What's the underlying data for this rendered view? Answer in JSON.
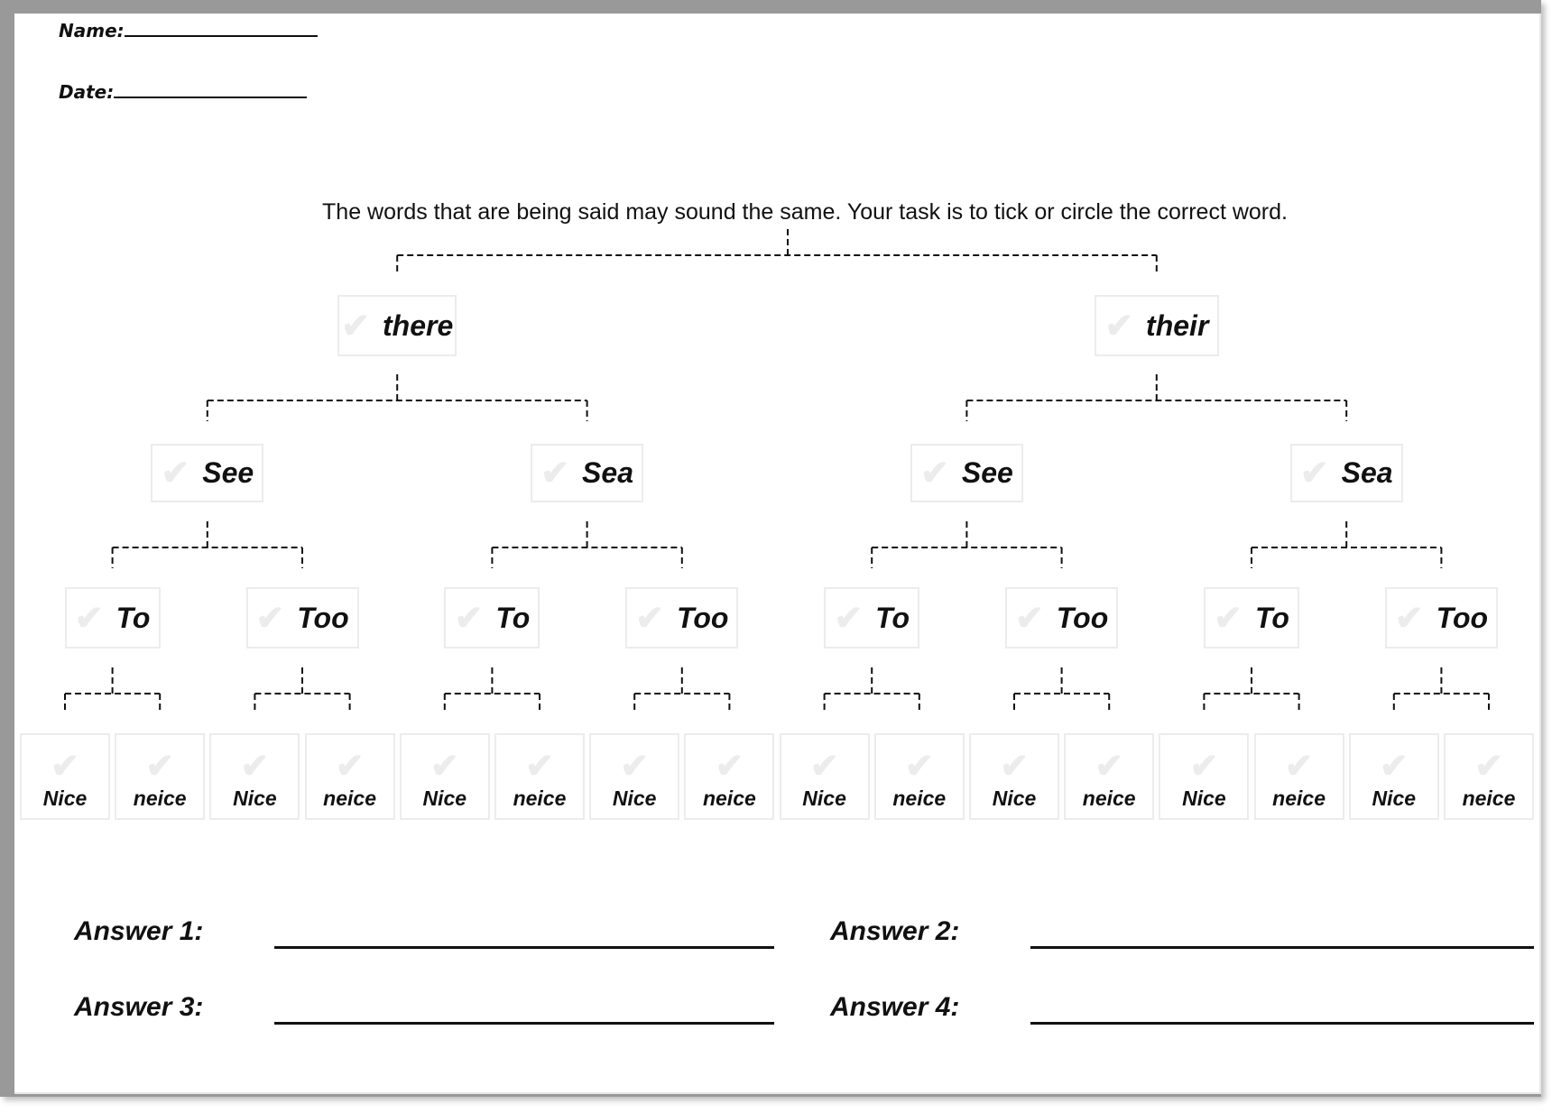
{
  "header": {
    "name_label": "Name:",
    "date_label": "Date:"
  },
  "instructions": "The words that are being said may sound the same. Your task is to tick or circle the correct word.",
  "icons": {
    "tick": "✔"
  },
  "tree": {
    "level1": [
      {
        "label": "there"
      },
      {
        "label": "their"
      }
    ],
    "level2": [
      {
        "label": "See"
      },
      {
        "label": "Sea"
      },
      {
        "label": "See"
      },
      {
        "label": "Sea"
      }
    ],
    "level3": [
      {
        "label": "To"
      },
      {
        "label": "Too"
      },
      {
        "label": "To"
      },
      {
        "label": "Too"
      },
      {
        "label": "To"
      },
      {
        "label": "Too"
      },
      {
        "label": "To"
      },
      {
        "label": "Too"
      }
    ],
    "leaves": [
      {
        "label": "Nice"
      },
      {
        "label": "neice"
      },
      {
        "label": "Nice"
      },
      {
        "label": "neice"
      },
      {
        "label": "Nice"
      },
      {
        "label": "neice"
      },
      {
        "label": "Nice"
      },
      {
        "label": "neice"
      },
      {
        "label": "Nice"
      },
      {
        "label": "neice"
      },
      {
        "label": "Nice"
      },
      {
        "label": "neice"
      },
      {
        "label": "Nice"
      },
      {
        "label": "neice"
      },
      {
        "label": "Nice"
      },
      {
        "label": "neice"
      }
    ]
  },
  "answers": [
    {
      "label": "Answer 1:",
      "value": ""
    },
    {
      "label": "Answer 2:",
      "value": ""
    },
    {
      "label": "Answer 3:",
      "value": ""
    },
    {
      "label": "Answer 4:",
      "value": ""
    }
  ]
}
